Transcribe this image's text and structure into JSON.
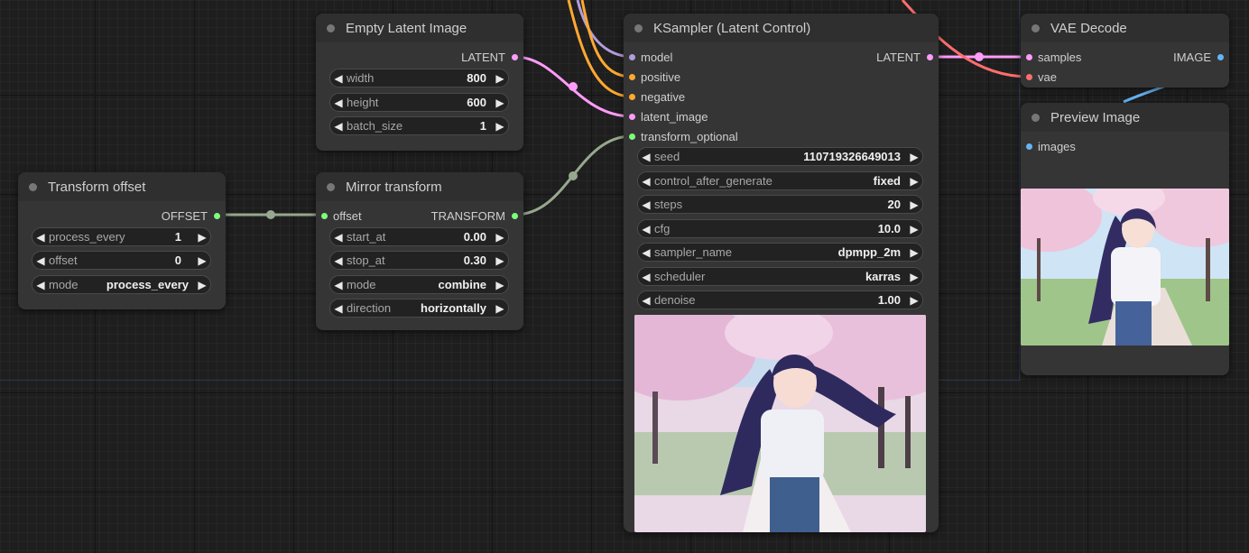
{
  "colors": {
    "latent": "#ff9cf9",
    "model": "#b39ddb",
    "conditioning": "#ffa931",
    "vae": "#ff6e6e",
    "image": "#64b5f6",
    "transform": "#7cff7c",
    "offset": "#7cff7c"
  },
  "nodes": {
    "empty_latent": {
      "title": "Empty Latent Image",
      "output": "LATENT",
      "widgets": [
        {
          "label": "width",
          "value": "800"
        },
        {
          "label": "height",
          "value": "600"
        },
        {
          "label": "batch_size",
          "value": "1"
        }
      ]
    },
    "transform_offset": {
      "title": "Transform offset",
      "output": "OFFSET",
      "widgets": [
        {
          "label": "process_every",
          "value": "1"
        },
        {
          "label": "offset",
          "value": "0"
        },
        {
          "label": "mode",
          "value": "process_every"
        }
      ]
    },
    "mirror_transform": {
      "title": "Mirror transform",
      "input": "offset",
      "output": "TRANSFORM",
      "widgets": [
        {
          "label": "start_at",
          "value": "0.00"
        },
        {
          "label": "stop_at",
          "value": "0.30"
        },
        {
          "label": "mode",
          "value": "combine"
        },
        {
          "label": "direction",
          "value": "horizontally"
        }
      ]
    },
    "ksampler": {
      "title": "KSampler (Latent Control)",
      "inputs": [
        "model",
        "positive",
        "negative",
        "latent_image",
        "transform_optional"
      ],
      "output": "LATENT",
      "widgets": [
        {
          "label": "seed",
          "value": "110719326649013"
        },
        {
          "label": "control_after_generate",
          "value": "fixed"
        },
        {
          "label": "steps",
          "value": "20"
        },
        {
          "label": "cfg",
          "value": "10.0"
        },
        {
          "label": "sampler_name",
          "value": "dpmpp_2m"
        },
        {
          "label": "scheduler",
          "value": "karras"
        },
        {
          "label": "denoise",
          "value": "1.00"
        }
      ]
    },
    "vae_decode": {
      "title": "VAE Decode",
      "inputs": [
        "samples",
        "vae"
      ],
      "output": "IMAGE"
    },
    "preview_image": {
      "title": "Preview Image",
      "input": "images"
    }
  },
  "icons": {
    "decrement": "◀",
    "increment": "▶"
  }
}
